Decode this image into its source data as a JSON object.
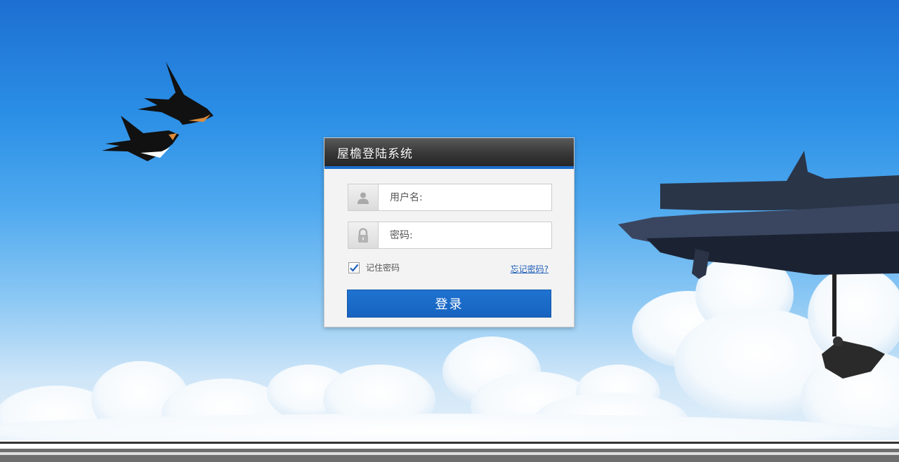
{
  "panel": {
    "title": "屋檐登陆系统"
  },
  "username": {
    "placeholder": "用户名:",
    "value": "",
    "icon": "user-icon"
  },
  "password": {
    "placeholder": "密码:",
    "value": "",
    "icon": "lock-icon"
  },
  "remember": {
    "label": "记住密码",
    "checked": true
  },
  "forgot": {
    "label": "忘记密码?"
  },
  "login_button": {
    "label": "登录"
  },
  "colors": {
    "accent": "#1c6ecb",
    "header_dark": "#2e2e2e",
    "link": "#1f5fb8"
  }
}
